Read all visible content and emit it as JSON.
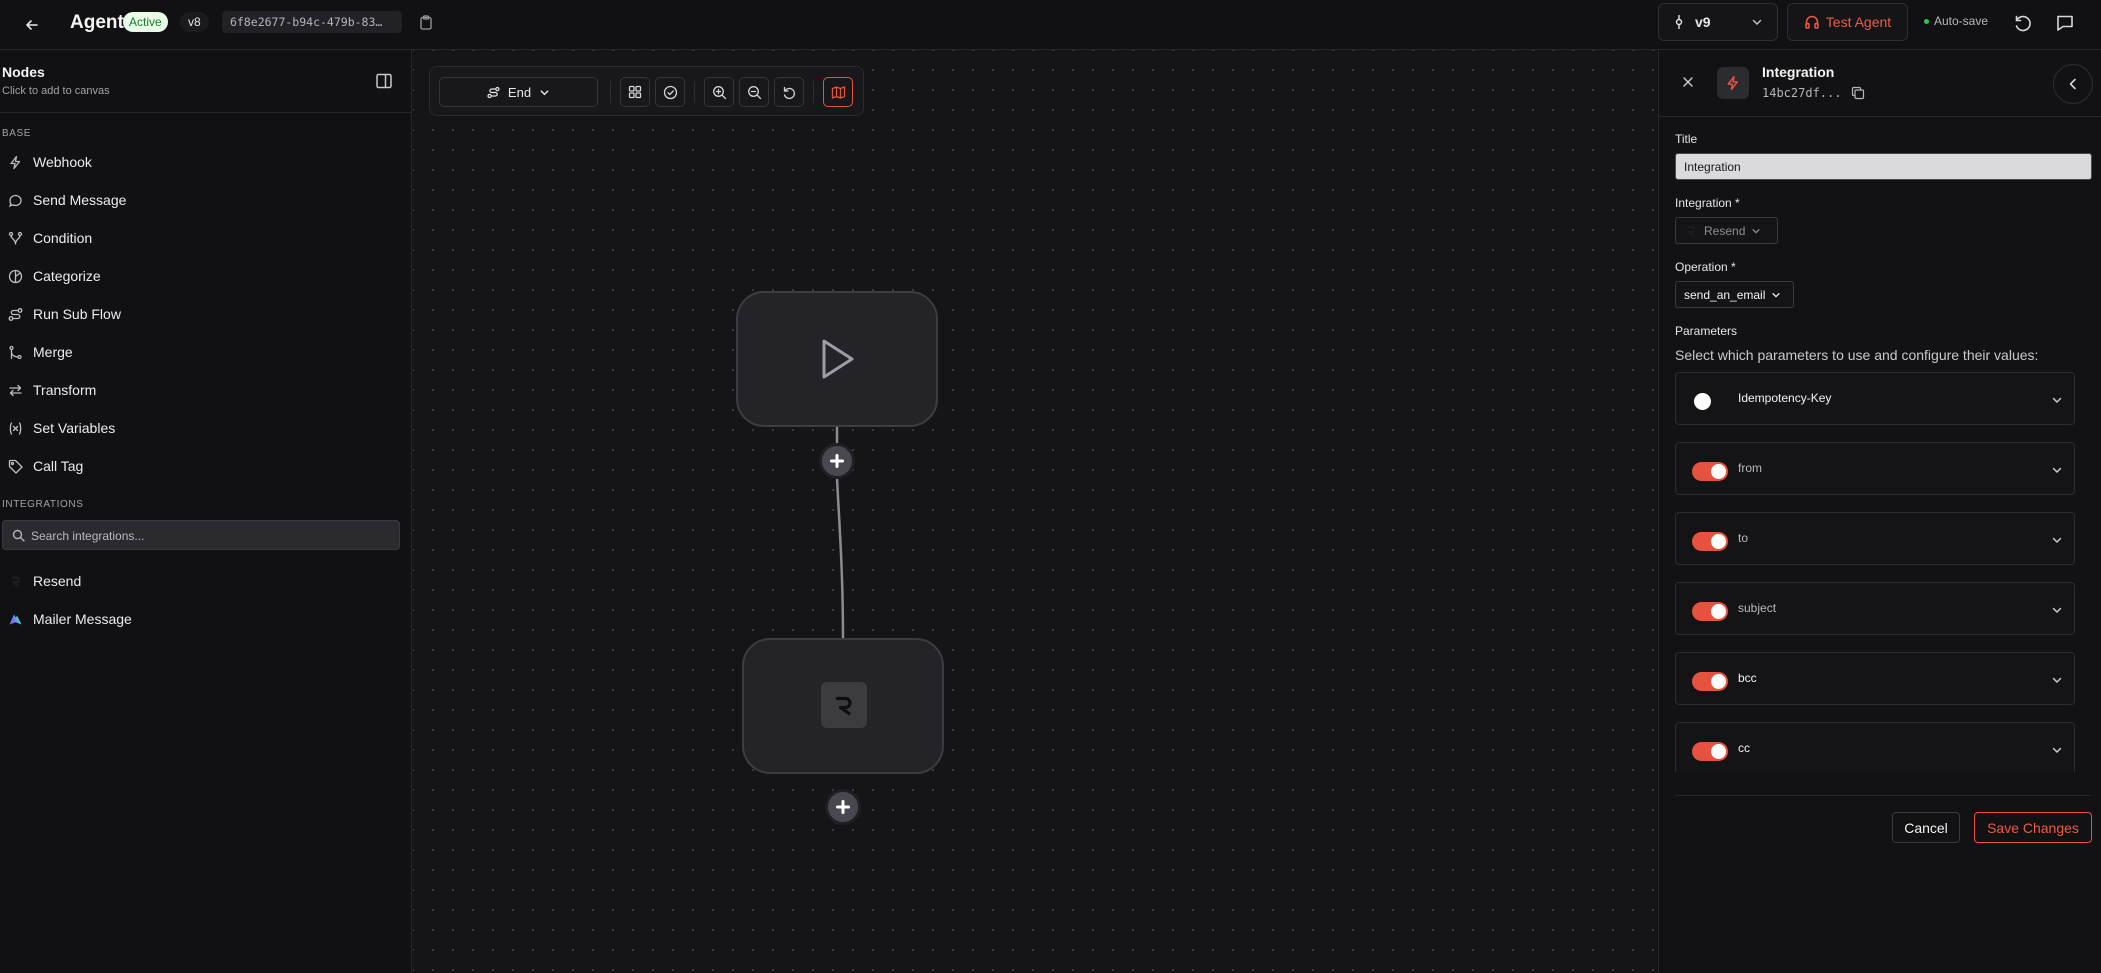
{
  "header": {
    "title": "Agent",
    "status": "Active",
    "version": "v8",
    "agent_id": "6f8e2677-b94c-479b-83…",
    "version_select": "v9",
    "test_button": "Test Agent",
    "autosave": "Auto-save"
  },
  "sidebar": {
    "title": "Nodes",
    "subtitle": "Click to add to canvas",
    "base_section": "Base",
    "base_items": [
      {
        "label": "Webhook",
        "icon": "lightning-icon"
      },
      {
        "label": "Send Message",
        "icon": "message-bubble-icon"
      },
      {
        "label": "Condition",
        "icon": "branch-icon"
      },
      {
        "label": "Categorize",
        "icon": "categorize-icon"
      },
      {
        "label": "Run Sub Flow",
        "icon": "route-icon"
      },
      {
        "label": "Merge",
        "icon": "merge-icon"
      },
      {
        "label": "Transform",
        "icon": "swap-arrows-icon"
      },
      {
        "label": "Set Variables",
        "icon": "variable-icon"
      },
      {
        "label": "Call Tag",
        "icon": "tag-icon"
      }
    ],
    "integrations_section": "Integrations",
    "search_placeholder": "Search integrations...",
    "integration_items": [
      {
        "label": "Resend",
        "icon": "resend-logo-icon"
      },
      {
        "label": "Mailer Message",
        "icon": "mailer-logo-icon"
      }
    ]
  },
  "canvas": {
    "toolbar": {
      "end_label": "End"
    }
  },
  "panel": {
    "title": "Integration",
    "node_id": "14bc27df...",
    "title_label": "Title",
    "title_value": "Integration",
    "integration_label": "Integration *",
    "integration_value": "Resend",
    "operation_label": "Operation *",
    "operation_value": "send_an_email",
    "parameters_label": "Parameters",
    "parameters_help": "Select which parameters to use and configure their values:",
    "parameters": [
      {
        "name": "Idempotency-Key",
        "enabled": false
      },
      {
        "name": "from",
        "enabled": true
      },
      {
        "name": "to",
        "enabled": true
      },
      {
        "name": "subject",
        "enabled": true
      },
      {
        "name": "bcc",
        "enabled": true
      },
      {
        "name": "cc",
        "enabled": true
      }
    ],
    "cancel_label": "Cancel",
    "save_label": "Save Changes"
  },
  "colors": {
    "accent": "#e5533f",
    "status_bg": "#e9fbe9",
    "status_text": "#177a2b",
    "autosave_dot": "#34c05b"
  }
}
